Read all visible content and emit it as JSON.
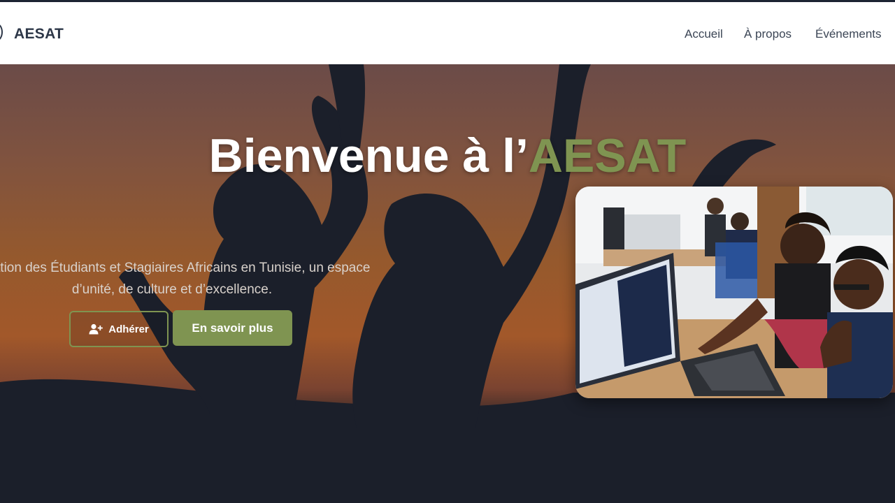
{
  "header": {
    "brand": "AESAT",
    "nav": [
      "Accueil",
      "À propos",
      "Événements"
    ]
  },
  "hero": {
    "title_main": "Bienvenue à l’",
    "title_accent": "AESAT",
    "description_line1": "ciation des Étudiants et Stagiaires Africains en Tunisie, un espace",
    "description_line2": "d’unité, de culture et d’excellence.",
    "join_button": "Adhérer",
    "more_button": "En savoir plus"
  },
  "colors": {
    "accent": "#7f9451",
    "header_text": "#2d3748",
    "dark_background": "#1b1f2a"
  },
  "icons": {
    "join_icon": "user-plus-icon",
    "logo": "logo-icon"
  }
}
